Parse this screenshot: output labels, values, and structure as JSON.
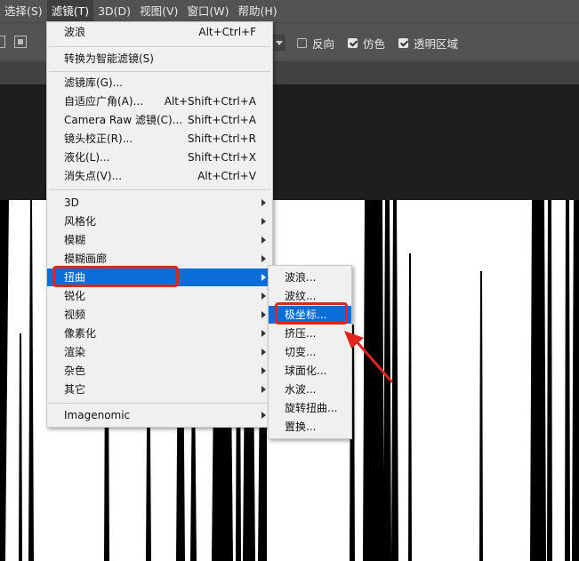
{
  "menubar": {
    "items": [
      "选择(S)",
      "滤镜(T)",
      "3D(D)",
      "视图(V)",
      "窗口(W)",
      "帮助(H)"
    ]
  },
  "options": {
    "invert": {
      "label": "反向",
      "checked": false
    },
    "dither": {
      "label": "仿色",
      "checked": true
    },
    "transparency": {
      "label": "透明区域",
      "checked": true
    }
  },
  "filter_menu": {
    "items": [
      {
        "label": "波浪",
        "shortcut": "Alt+Ctrl+F"
      },
      {
        "label": "转换为智能滤镜(S)",
        "shortcut": ""
      },
      {
        "label": "滤镜库(G)...",
        "shortcut": ""
      },
      {
        "label": "自适应广角(A)...",
        "shortcut": "Alt+Shift+Ctrl+A"
      },
      {
        "label": "Camera Raw 滤镜(C)...",
        "shortcut": "Shift+Ctrl+A"
      },
      {
        "label": "镜头校正(R)...",
        "shortcut": "Shift+Ctrl+R"
      },
      {
        "label": "液化(L)...",
        "shortcut": "Shift+Ctrl+X"
      },
      {
        "label": "消失点(V)...",
        "shortcut": "Alt+Ctrl+V"
      },
      {
        "label": "3D",
        "shortcut": ""
      },
      {
        "label": "风格化",
        "shortcut": ""
      },
      {
        "label": "模糊",
        "shortcut": ""
      },
      {
        "label": "模糊画廊",
        "shortcut": ""
      },
      {
        "label": "扭曲",
        "shortcut": ""
      },
      {
        "label": "锐化",
        "shortcut": ""
      },
      {
        "label": "视频",
        "shortcut": ""
      },
      {
        "label": "像素化",
        "shortcut": ""
      },
      {
        "label": "渲染",
        "shortcut": ""
      },
      {
        "label": "杂色",
        "shortcut": ""
      },
      {
        "label": "其它",
        "shortcut": ""
      },
      {
        "label": "Imagenomic",
        "shortcut": ""
      }
    ]
  },
  "distort_menu": {
    "items": [
      "波浪...",
      "波纹...",
      "极坐标...",
      "挤压...",
      "切变...",
      "球面化...",
      "水波...",
      "旋转扭曲...",
      "置换..."
    ]
  },
  "colors": {
    "highlight": "#0a6dd8",
    "annotation": "#e0241e"
  }
}
